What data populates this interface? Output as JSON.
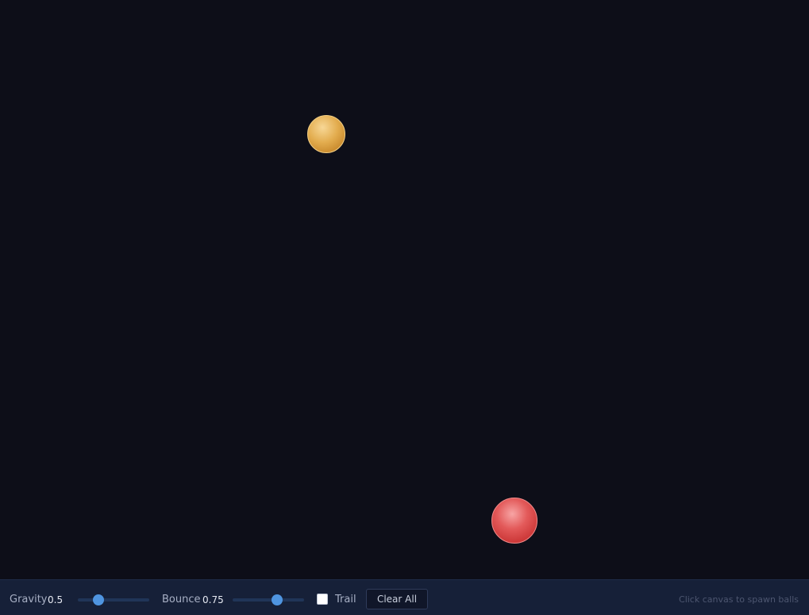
{
  "canvas": {
    "balls": [
      {
        "color": "#e3ad4f"
      },
      {
        "color": "#e35a5a"
      }
    ]
  },
  "controls": {
    "gravity": {
      "label": "Gravity",
      "value": "0.5"
    },
    "bounce": {
      "label": "Bounce",
      "value": "0.75"
    },
    "trail": {
      "label": "Trail",
      "checked": false
    },
    "clear_label": "Clear All",
    "hint": "Click canvas to spawn balls"
  },
  "colors": {
    "background": "#0d0e18",
    "toolbar": "#162038",
    "accent": "#4f95e0"
  }
}
